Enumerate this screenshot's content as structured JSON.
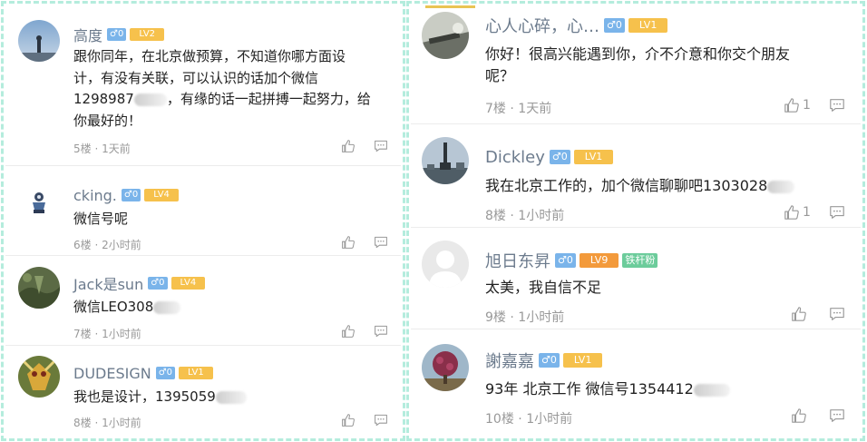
{
  "left_panel": {
    "comments": [
      {
        "username": "高度",
        "gender": "♂0",
        "level": "LV2",
        "lines": [
          "跟你同年，在北京做预算，不知道你哪方面设",
          "计，有没有关联，可以认识的话加个微信",
          "1298987",
          "，有缘的话一起拼搏一起努力，给",
          "你最好的！"
        ],
        "floor": "5楼",
        "time": "1天前"
      },
      {
        "username": "cking.",
        "gender": "♂0",
        "level": "LV4",
        "lines": [
          "微信号呢"
        ],
        "floor": "6楼",
        "time": "2小时前"
      },
      {
        "username": "Jack是sun",
        "gender": "♂0",
        "level": "LV4",
        "lines": [
          "微信LEO308"
        ],
        "floor": "7楼",
        "time": "1小时前"
      },
      {
        "username": "DUDESIGN",
        "gender": "♂0",
        "level": "LV1",
        "lines": [
          "我也是设计，1395059"
        ],
        "floor": "8楼",
        "time": "1小时前"
      }
    ]
  },
  "right_panel": {
    "comments": [
      {
        "username": "心人心碎，心…",
        "gender": "♂0",
        "level": "LV1",
        "lines": [
          "你好！很高兴能遇到你，介不介意和你交个朋友",
          "呢？"
        ],
        "floor": "7楼",
        "time": "1天前",
        "likes": "1"
      },
      {
        "username": "Dickley",
        "gender": "♂0",
        "level": "LV1",
        "lines": [
          "我在北京工作的，加个微信聊聊吧1303028"
        ],
        "floor": "8楼",
        "time": "1小时前",
        "likes": "1"
      },
      {
        "username": "旭日东昇",
        "gender": "♂0",
        "level": "LV9",
        "badge": "铁杆粉",
        "lines": [
          "太美，我自信不足"
        ],
        "floor": "9楼",
        "time": "1小时前"
      },
      {
        "username": "謝嘉嘉",
        "gender": "♂0",
        "level": "LV1",
        "lines": [
          "93年 北京工作 微信号1354412"
        ],
        "floor": "10楼",
        "time": "1小时前"
      }
    ]
  },
  "meta_separator": "·",
  "colors": {
    "username": "#6c7b8d",
    "gender_badge": "#7ab4ea",
    "level_badge": "#f6c14c",
    "level_badge_high": "#f39a3b",
    "fan_badge": "#6ccc9b",
    "frame_dash": "#b4ecdd"
  },
  "icons": [
    "thumbs-up-icon",
    "comment-icon"
  ]
}
